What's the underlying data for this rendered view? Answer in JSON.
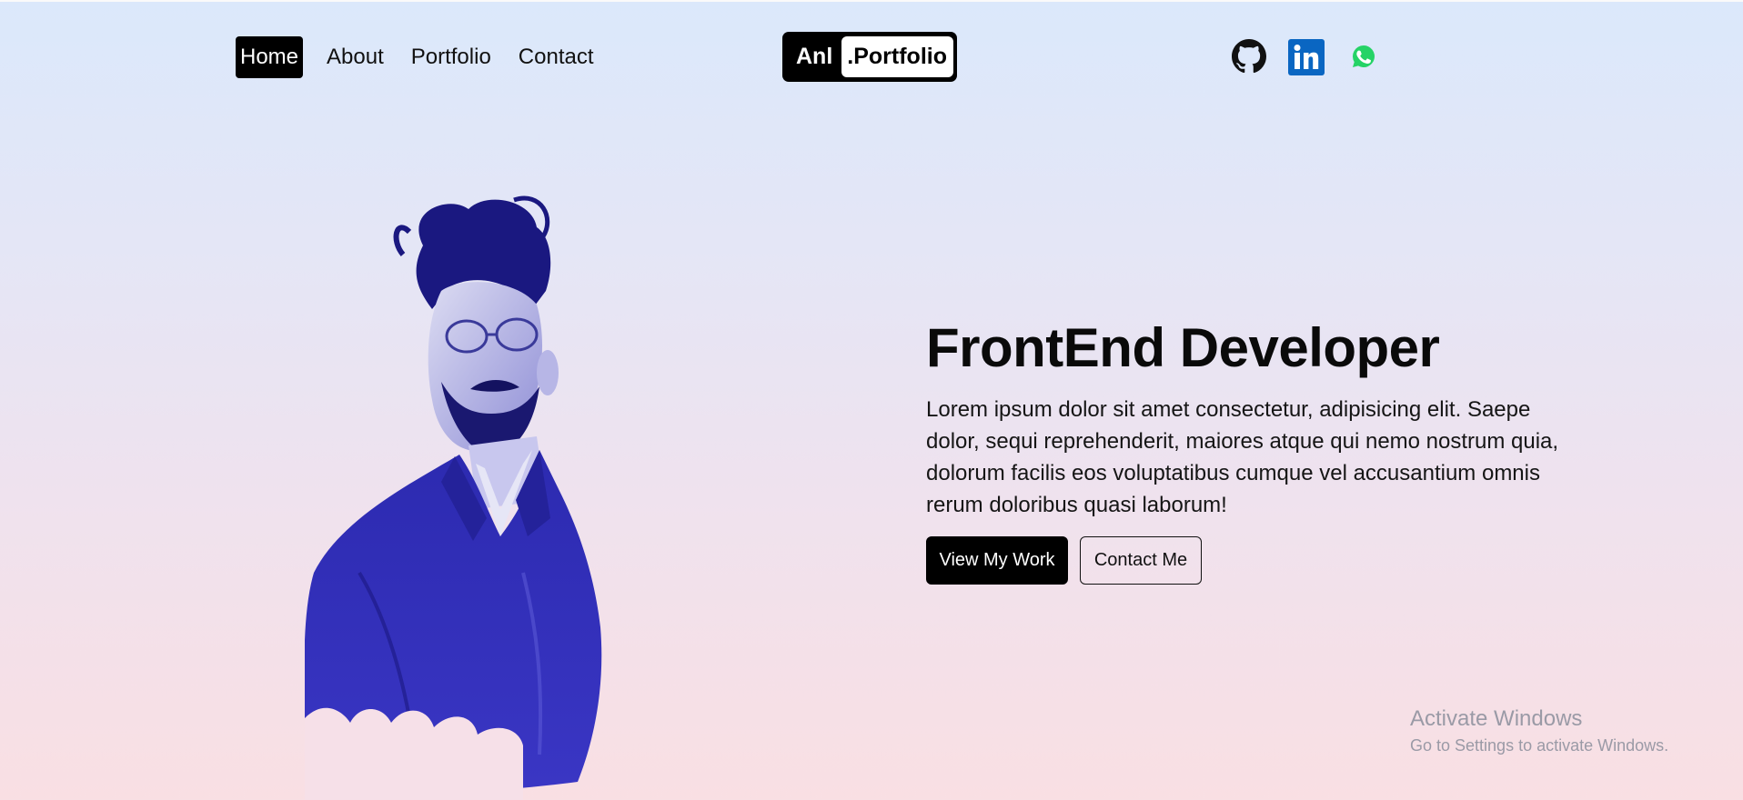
{
  "nav": {
    "links": [
      {
        "label": "Home",
        "active": true
      },
      {
        "label": "About",
        "active": false
      },
      {
        "label": "Portfolio",
        "active": false
      },
      {
        "label": "Contact",
        "active": false
      }
    ]
  },
  "logo": {
    "part1": "Anl",
    "part2": ".Portfolio"
  },
  "social": [
    {
      "name": "github-icon"
    },
    {
      "name": "linkedin-icon",
      "color": "#0a66c2"
    },
    {
      "name": "whatsapp-icon",
      "color": "#25d366"
    }
  ],
  "hero": {
    "title": "FrontEnd Developer",
    "description": "Lorem ipsum dolor sit amet consectetur, adipisicing elit. Saepe dolor, sequi reprehenderit, maiores atque qui nemo nostrum quia, dolorum facilis eos voluptatibus cumque vel accusantium omnis rerum doloribus quasi laborum!",
    "primary_button": "View My Work",
    "secondary_button": "Contact Me"
  },
  "watermark": {
    "title": "Activate Windows",
    "subtitle": "Go to Settings to activate Windows."
  },
  "colors": {
    "accent": "#000000",
    "portrait": "#2a2aa8"
  }
}
